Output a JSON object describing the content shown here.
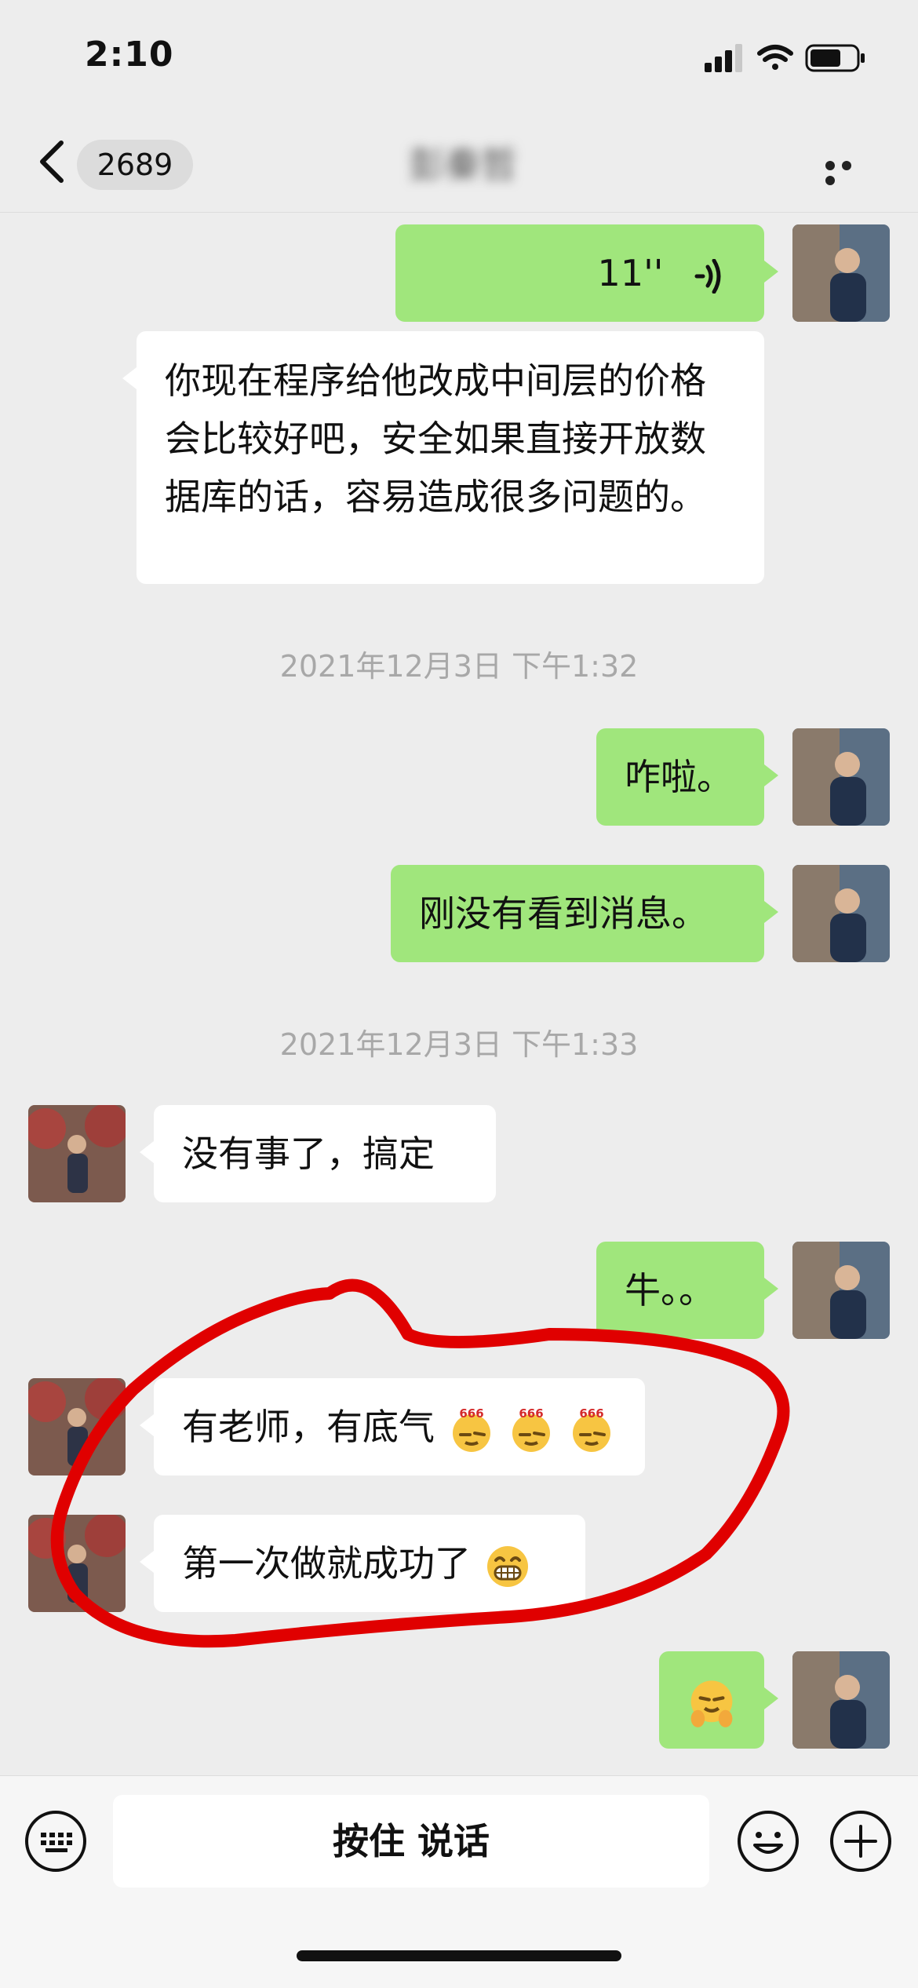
{
  "status_bar": {
    "time": "2:10"
  },
  "nav": {
    "unread_count": "2689",
    "chat_title": "彭秦哲"
  },
  "messages": {
    "voice": {
      "duration": "11''"
    },
    "m1": "你现在程序给他改成中间层的价格会比较好吧，安全如果直接开放数据库的话，容易造成很多问题的。",
    "ts1": "2021年12月3日 下午1:32",
    "m2": "咋啦。",
    "m3": "刚没有看到消息。",
    "ts2": "2021年12月3日 下午1:33",
    "m4": "没有事了，搞定",
    "m5": "牛。。",
    "m6": "有老师，有底气",
    "m6_emoji": "666",
    "m7": "第一次做就成功了"
  },
  "input_bar": {
    "hold_to_talk": "按住 说话"
  },
  "icons": [
    "back-chevron-icon",
    "more-dots-icon",
    "voice-wave-icon",
    "keyboard-icon",
    "emoji-icon",
    "plus-icon",
    "signal-icon",
    "wifi-icon",
    "battery-icon"
  ],
  "colors": {
    "sent_bubble": "#a0e67c",
    "received_bubble": "#ffffff",
    "annotation": "#e00000"
  }
}
